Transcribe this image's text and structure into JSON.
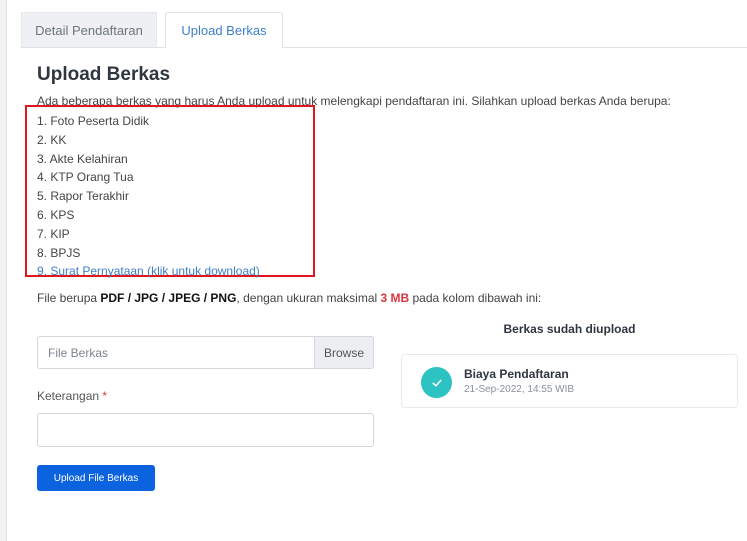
{
  "tabs": [
    {
      "label": "Detail Pendaftaran",
      "active": false
    },
    {
      "label": "Upload Berkas",
      "active": true
    }
  ],
  "title": "Upload Berkas",
  "intro": "Ada beberapa berkas yang harus Anda upload untuk melengkapi pendaftaran ini. Silahkan upload berkas Anda berupa:",
  "documents": [
    "1. Foto Peserta Didik",
    "2. KK",
    "3. Akte Kelahiran",
    "4. KTP Orang Tua",
    "5. Rapor Terakhir",
    "6. KPS",
    "7. KIP",
    "8. BPJS",
    "9. Surat Pernyataan (klik untuk download)"
  ],
  "format_note": {
    "prefix": "File berupa ",
    "formats": "PDF / JPG / JPEG / PNG",
    "middle": ", dengan ukuran maksimal ",
    "max_size": "3 MB",
    "suffix": " pada kolom dibawah ini:"
  },
  "file_input": {
    "placeholder": "File Berkas",
    "browse_label": "Browse"
  },
  "keterangan": {
    "label": "Keterangan",
    "required_mark": "*",
    "value": ""
  },
  "upload_button": "Upload File Berkas",
  "uploaded": {
    "title": "Berkas sudah diupload",
    "items": [
      {
        "name": "Biaya Pendaftaran",
        "date": "21-Sep-2022, 14:55 WIB",
        "icon": "check-icon"
      }
    ]
  },
  "colors": {
    "accent": "#0b63e0",
    "link": "#3d7fc9",
    "highlight_border": "#e0171e",
    "check_circle": "#2dc3c3",
    "size_text": "#d9363e"
  }
}
